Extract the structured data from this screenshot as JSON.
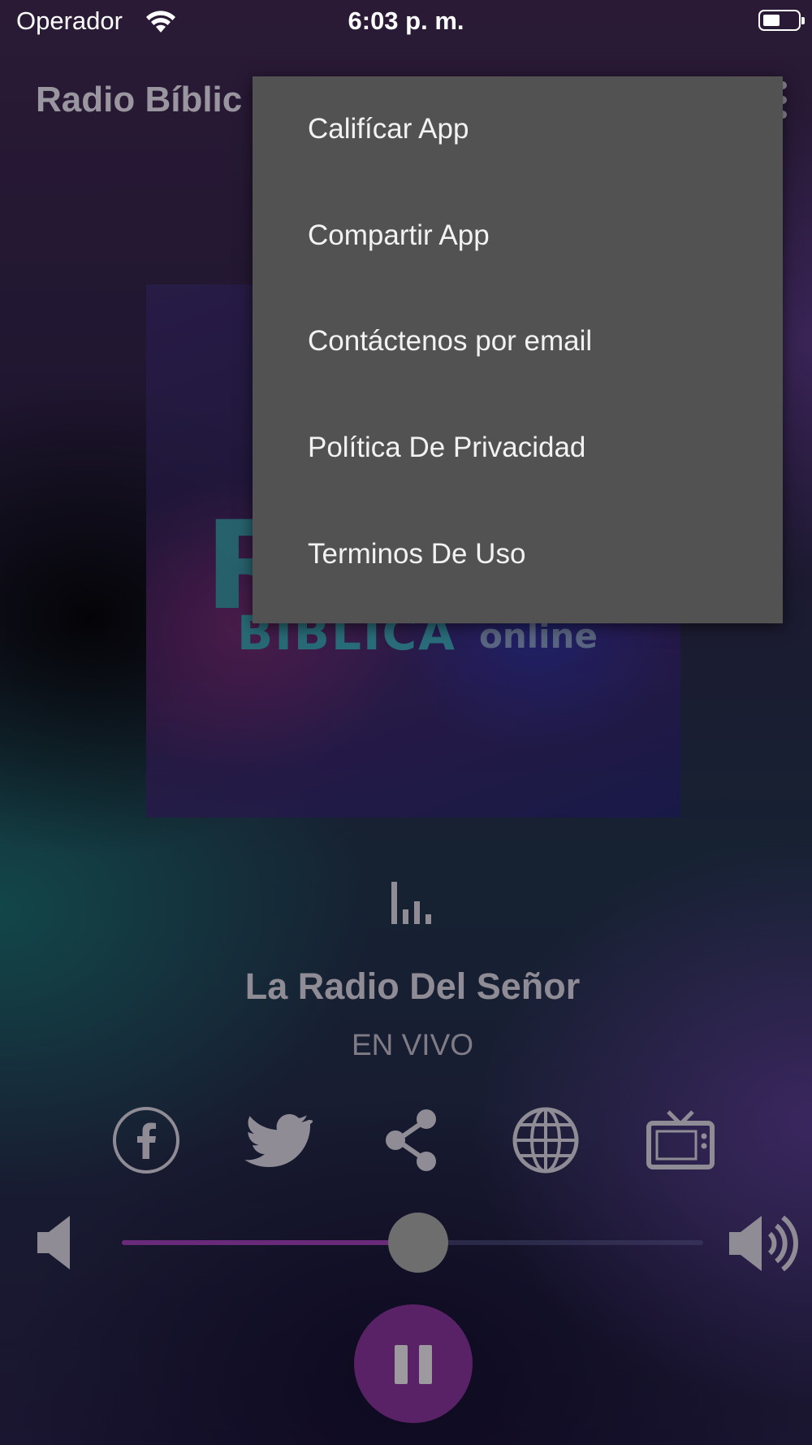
{
  "status_bar": {
    "carrier": "Operador",
    "time": "6:03 p. m.",
    "wifi_icon": "wifi-icon",
    "battery_icon": "battery-icon"
  },
  "app_bar": {
    "title": "Radio Bíblic",
    "overflow_icon": "more-vertical-icon"
  },
  "artwork": {
    "logo_r": "R",
    "logo_text": "BIBLICA",
    "logo_online": "online"
  },
  "overflow_menu": {
    "items": [
      {
        "label": "Califícar App"
      },
      {
        "label": "Compartir App"
      },
      {
        "label": "Contáctenos por email"
      },
      {
        "label": "Política De Privacidad"
      },
      {
        "label": "Terminos De Uso"
      }
    ]
  },
  "player": {
    "station_name": "La Radio Del Señor",
    "status": "EN VIVO",
    "equalizer_icon": "equalizer-icon",
    "social_icons": [
      "facebook-icon",
      "twitter-icon",
      "share-icon",
      "globe-icon",
      "tv-icon"
    ],
    "volume_percent": 51,
    "play_state_icon": "pause-icon"
  },
  "colors": {
    "accent": "#5a2266",
    "slider_fill": "#6a2a7a",
    "menu_bg": "#525252",
    "menu_text": "#f2f2f2"
  }
}
